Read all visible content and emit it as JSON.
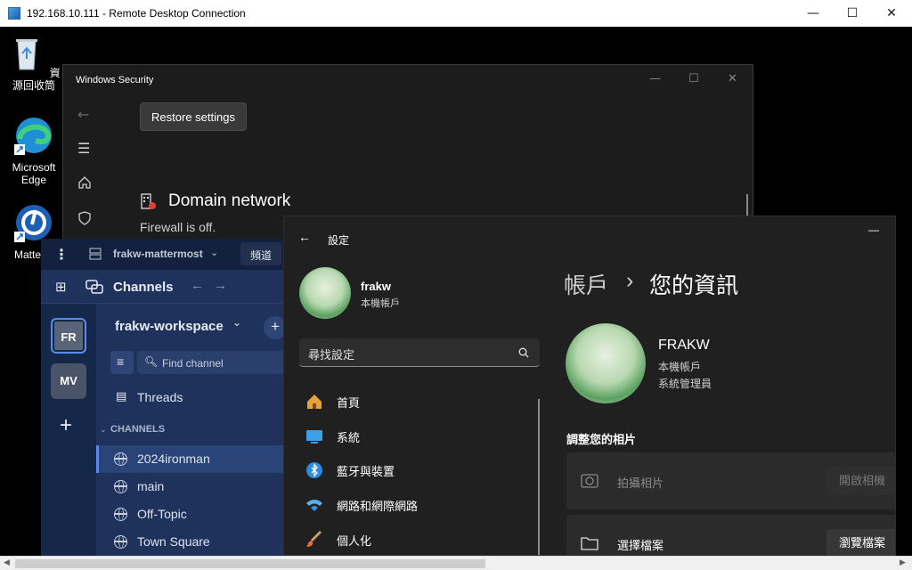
{
  "rdp": {
    "title": "192.168.10.111 - Remote Desktop Connection",
    "minimize": "—",
    "maximize": "☐",
    "close": "✕"
  },
  "desktop": {
    "icons": [
      {
        "label": "資源回收筒"
      },
      {
        "label": "Microsoft Edge"
      },
      {
        "label": "Matterm"
      }
    ]
  },
  "winsec": {
    "title": "Windows Security",
    "restore_label": "Restore settings",
    "section_title": "Domain network",
    "status": "Firewall is off."
  },
  "mattermost": {
    "server_name": "frakw-mattermost",
    "tab_label": "頻道",
    "header_title": "Channels",
    "workspace_name": "frakw-workspace",
    "find_placeholder": "Find channel",
    "threads_label": "Threads",
    "channels_header": "CHANNELS",
    "teams": [
      "FR",
      "MV"
    ],
    "channels": [
      {
        "label": "2024ironman",
        "active": true
      },
      {
        "label": "main",
        "active": false
      },
      {
        "label": "Off-Topic",
        "active": false
      },
      {
        "label": "Town Square",
        "active": false
      }
    ]
  },
  "settings": {
    "app_title": "設定",
    "user_name": "frakw",
    "user_type": "本機帳戶",
    "search_placeholder": "尋找設定",
    "nav": [
      {
        "label": "首頁",
        "icon": "home-icon"
      },
      {
        "label": "系統",
        "icon": "monitor-icon"
      },
      {
        "label": "藍牙與裝置",
        "icon": "bluetooth-icon"
      },
      {
        "label": "網路和網際網路",
        "icon": "wifi-icon"
      },
      {
        "label": "個人化",
        "icon": "brush-icon"
      }
    ],
    "breadcrumb_parent": "帳戶",
    "breadcrumb_sep": "›",
    "breadcrumb_current": "您的資訊",
    "profile_name": "FRAKW",
    "profile_type": "本機帳戶",
    "profile_role": "系統管理員",
    "adjust_photo_heading": "調整您的相片",
    "take_photo_label": "拍攝相片",
    "open_camera_label": "開啟相機",
    "choose_file_label": "選擇檔案",
    "browse_label": "瀏覽檔案",
    "minimize": "—"
  },
  "colors": {
    "mm_bg": "#1e325c",
    "mm_active": "#2a4478",
    "settings_bg": "#202020",
    "winsec_bg": "#1c1c1c"
  }
}
